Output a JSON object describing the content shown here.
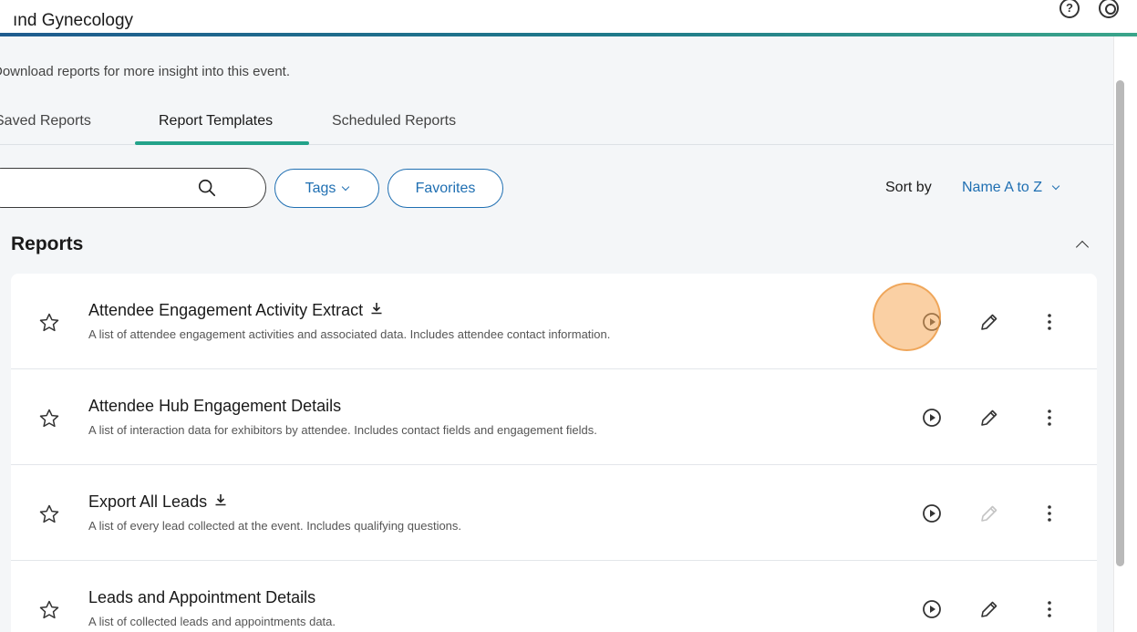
{
  "header": {
    "title": "ınd Gynecology",
    "help_icon": "help-circle-icon",
    "user_icon": "user-circle-icon"
  },
  "page": {
    "subtitle": "Download reports for more insight into this event."
  },
  "tabs": [
    {
      "label": "Saved Reports",
      "active": false
    },
    {
      "label": "Report Templates",
      "active": true
    },
    {
      "label": "Scheduled Reports",
      "active": false
    }
  ],
  "toolbar": {
    "search_value": "",
    "tags_label": "Tags",
    "favorites_label": "Favorites",
    "sort_label": "Sort by",
    "sort_value": "Name A to Z"
  },
  "section": {
    "title": "Reports"
  },
  "reports": [
    {
      "name": "Attendee Engagement Activity Extract",
      "description": "A list of attendee engagement activities and associated data. Includes attendee contact information.",
      "downloadable": true,
      "edit_enabled": true
    },
    {
      "name": "Attendee Hub Engagement Details",
      "description": "A list of interaction data for exhibitors by attendee. Includes contact fields and engagement fields.",
      "downloadable": false,
      "edit_enabled": true
    },
    {
      "name": "Export All Leads",
      "description": "A list of every lead collected at the event. Includes qualifying questions.",
      "downloadable": true,
      "edit_enabled": false
    },
    {
      "name": "Leads and Appointment Details",
      "description": "A list of collected leads and appointments data.",
      "downloadable": false,
      "edit_enabled": true
    }
  ],
  "colors": {
    "accent": "#1f6fb2",
    "tab_underline": "#23a38a",
    "highlight": "#f5aa5a"
  }
}
